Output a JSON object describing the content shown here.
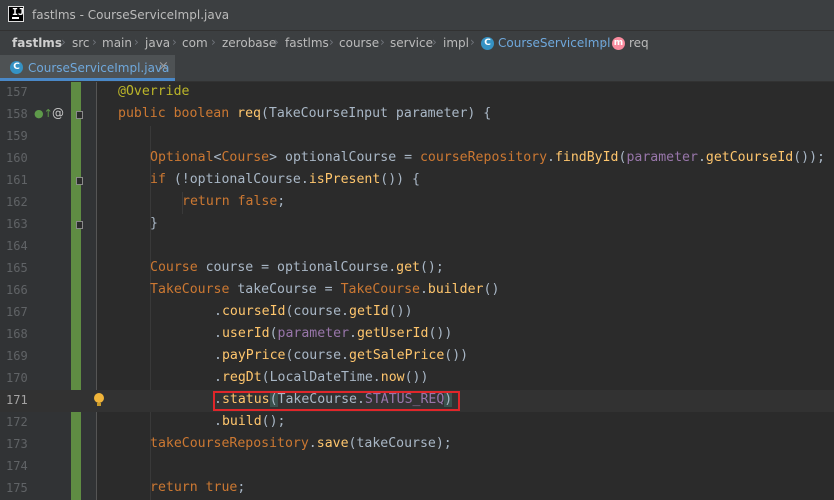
{
  "window": {
    "title": "fastlms - CourseServiceImpl.java"
  },
  "breadcrumb": {
    "items": [
      "fastlms",
      "src",
      "main",
      "java",
      "com",
      "zerobase",
      "fastlms",
      "course",
      "service",
      "impl",
      "CourseServiceImpl",
      "req"
    ]
  },
  "tab": {
    "label": "CourseServiceImpl.java",
    "close": "×"
  },
  "icons": {
    "class_letter": "C",
    "method_letter": "m",
    "app_letter": "IJ"
  },
  "editor": {
    "current_line": 171,
    "lines": [
      {
        "n": "157"
      },
      {
        "n": "158"
      },
      {
        "n": "159"
      },
      {
        "n": "160"
      },
      {
        "n": "161"
      },
      {
        "n": "162"
      },
      {
        "n": "163"
      },
      {
        "n": "164"
      },
      {
        "n": "165"
      },
      {
        "n": "166"
      },
      {
        "n": "167"
      },
      {
        "n": "168"
      },
      {
        "n": "169"
      },
      {
        "n": "170"
      },
      {
        "n": "171"
      },
      {
        "n": "172"
      },
      {
        "n": "173"
      },
      {
        "n": "174"
      },
      {
        "n": "175"
      }
    ],
    "tokens": {
      "l157": [
        "@Override"
      ],
      "l158": [
        "public",
        "boolean",
        "req",
        "(TakeCourseInput parameter) {"
      ],
      "l160": [
        "Optional",
        "<",
        "Course",
        "> optionalCourse = ",
        "courseRepository",
        ".",
        "findById",
        "(",
        "parameter",
        ".",
        "getCourseId",
        "());"
      ],
      "l161": [
        "if",
        " (!optionalCourse.",
        "isPresent",
        "()) {"
      ],
      "l162": [
        "return",
        "false",
        ";"
      ],
      "l163": [
        "}"
      ],
      "l165": [
        "Course",
        " course = optionalCourse.",
        "get",
        "();"
      ],
      "l166": [
        "TakeCourse",
        " takeCourse = ",
        "TakeCourse",
        ".",
        "builder",
        "()"
      ],
      "l167": [
        ".",
        "courseId",
        "(course.",
        "getId",
        "())"
      ],
      "l168": [
        ".",
        "userId",
        "(",
        "parameter",
        ".",
        "getUserId",
        "())"
      ],
      "l169": [
        ".",
        "payPrice",
        "(course.",
        "getSalePrice",
        "())"
      ],
      "l170": [
        ".",
        "regDt",
        "(LocalDateTime.",
        "now",
        "())"
      ],
      "l171": [
        ".",
        "status",
        "(",
        "TakeCourse.",
        "STATUS_REQ",
        ")"
      ],
      "l172": [
        ".",
        "build",
        "();"
      ],
      "l173": [
        "takeCourseRepository",
        ".",
        "save",
        "(takeCourse);"
      ],
      "l175": [
        "return",
        "true",
        ";"
      ]
    }
  },
  "colors": {
    "keyword": "#cc7832",
    "annotation": "#bbb529",
    "method": "#ffc66d",
    "field": "#9876aa",
    "text": "#a9b7c6",
    "background": "#2b2b2b",
    "highlight_box": "#e0262a"
  }
}
